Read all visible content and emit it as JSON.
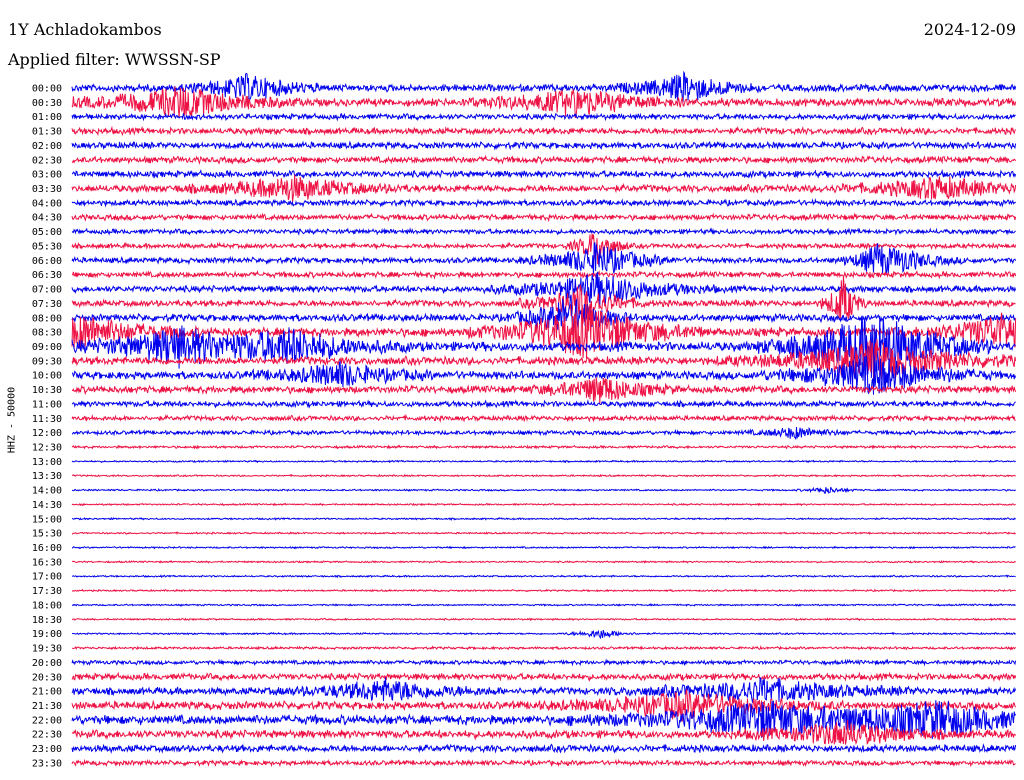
{
  "header": {
    "station": "1Y Achladokambos",
    "date": "2024-12-09",
    "filter": "Applied filter: WWSSN-SP"
  },
  "colors": {
    "trace_a": "#0000ee",
    "trace_b": "#ee1144",
    "background": "#ffffff"
  },
  "chart_data": {
    "type": "line",
    "title": "1Y Achladokambos",
    "subtitle": "Applied filter: WWSSN-SP",
    "ylabel": "HHZ - 50000",
    "date": "2024-12-09",
    "row_labels": [
      "00:00",
      "00:30",
      "01:00",
      "01:30",
      "02:00",
      "02:30",
      "03:00",
      "03:30",
      "04:00",
      "04:30",
      "05:00",
      "05:30",
      "06:00",
      "06:30",
      "07:00",
      "07:30",
      "08:00",
      "08:30",
      "09:00",
      "09:30",
      "10:00",
      "10:30",
      "11:00",
      "11:30",
      "12:00",
      "12:30",
      "13:00",
      "13:30",
      "14:00",
      "14:30",
      "15:00",
      "15:30",
      "16:00",
      "16:30",
      "17:00",
      "17:30",
      "18:00",
      "18:30",
      "19:00",
      "19:30",
      "20:00",
      "20:30",
      "21:00",
      "21:30",
      "22:00",
      "22:30",
      "23:00",
      "23:30"
    ],
    "row_colors": [
      "blue",
      "red"
    ],
    "noise_level": [
      0.9,
      1.0,
      0.7,
      0.8,
      0.8,
      0.8,
      0.8,
      0.9,
      0.7,
      0.7,
      0.6,
      0.6,
      0.7,
      0.7,
      0.8,
      0.8,
      0.9,
      1.1,
      1.2,
      1.0,
      1.0,
      0.9,
      0.7,
      0.6,
      0.5,
      0.3,
      0.2,
      0.2,
      0.2,
      0.2,
      0.2,
      0.2,
      0.2,
      0.2,
      0.2,
      0.2,
      0.2,
      0.2,
      0.2,
      0.3,
      0.5,
      0.8,
      0.9,
      1.0,
      1.2,
      1.0,
      0.9,
      0.6
    ],
    "events": [
      {
        "row": 0,
        "x_min": 5.6,
        "amp": 1.4,
        "width_min": 1.0
      },
      {
        "row": 0,
        "x_min": 19.5,
        "amp": 1.6,
        "width_min": 1.0
      },
      {
        "row": 1,
        "x_min": 3.5,
        "amp": 1.6,
        "width_min": 1.5
      },
      {
        "row": 1,
        "x_min": 16.0,
        "amp": 1.3,
        "width_min": 1.5
      },
      {
        "row": 7,
        "x_min": 7.0,
        "amp": 1.3,
        "width_min": 1.5
      },
      {
        "row": 7,
        "x_min": 27.5,
        "amp": 1.2,
        "width_min": 1.5
      },
      {
        "row": 11,
        "x_min": 16.7,
        "amp": 3.5,
        "width_min": 0.4
      },
      {
        "row": 12,
        "x_min": 16.7,
        "amp": 2.5,
        "width_min": 1.0
      },
      {
        "row": 12,
        "x_min": 25.6,
        "amp": 2.0,
        "width_min": 0.5
      },
      {
        "row": 12,
        "x_min": 26.5,
        "amp": 1.3,
        "width_min": 0.8
      },
      {
        "row": 14,
        "x_min": 16.8,
        "amp": 2.0,
        "width_min": 1.5
      },
      {
        "row": 15,
        "x_min": 16.2,
        "amp": 2.5,
        "width_min": 0.8
      },
      {
        "row": 15,
        "x_min": 24.5,
        "amp": 3.5,
        "width_min": 0.3
      },
      {
        "row": 16,
        "x_min": 15.8,
        "amp": 2.5,
        "width_min": 0.8
      },
      {
        "row": 17,
        "x_min": 16.3,
        "amp": 2.5,
        "width_min": 1.5
      },
      {
        "row": 17,
        "x_min": 0.3,
        "amp": 1.5,
        "width_min": 1.5
      },
      {
        "row": 17,
        "x_min": 29.5,
        "amp": 1.6,
        "width_min": 1.2
      },
      {
        "row": 18,
        "x_min": 25.5,
        "amp": 3.0,
        "width_min": 1.5
      },
      {
        "row": 18,
        "x_min": 3.3,
        "amp": 1.5,
        "width_min": 1.5
      },
      {
        "row": 18,
        "x_min": 7.0,
        "amp": 1.4,
        "width_min": 1.5
      },
      {
        "row": 19,
        "x_min": 25.5,
        "amp": 2.0,
        "width_min": 2.0
      },
      {
        "row": 20,
        "x_min": 25.5,
        "amp": 2.0,
        "width_min": 1.5
      },
      {
        "row": 20,
        "x_min": 8.5,
        "amp": 1.2,
        "width_min": 1.2
      },
      {
        "row": 21,
        "x_min": 16.8,
        "amp": 1.5,
        "width_min": 1.0
      },
      {
        "row": 24,
        "x_min": 23.0,
        "amp": 1.2,
        "width_min": 0.7
      },
      {
        "row": 28,
        "x_min": 24.0,
        "amp": 1.8,
        "width_min": 0.4
      },
      {
        "row": 38,
        "x_min": 16.8,
        "amp": 2.5,
        "width_min": 0.5
      },
      {
        "row": 42,
        "x_min": 10.0,
        "amp": 1.2,
        "width_min": 1.5
      },
      {
        "row": 42,
        "x_min": 22.0,
        "amp": 1.3,
        "width_min": 2.0
      },
      {
        "row": 43,
        "x_min": 19.5,
        "amp": 1.3,
        "width_min": 2.0
      },
      {
        "row": 44,
        "x_min": 22.0,
        "amp": 1.4,
        "width_min": 2.5
      },
      {
        "row": 44,
        "x_min": 27.5,
        "amp": 1.3,
        "width_min": 2.0
      },
      {
        "row": 45,
        "x_min": 24.5,
        "amp": 1.2,
        "width_min": 1.5
      }
    ],
    "xlim_min": [
      0,
      30
    ],
    "grid": false
  }
}
